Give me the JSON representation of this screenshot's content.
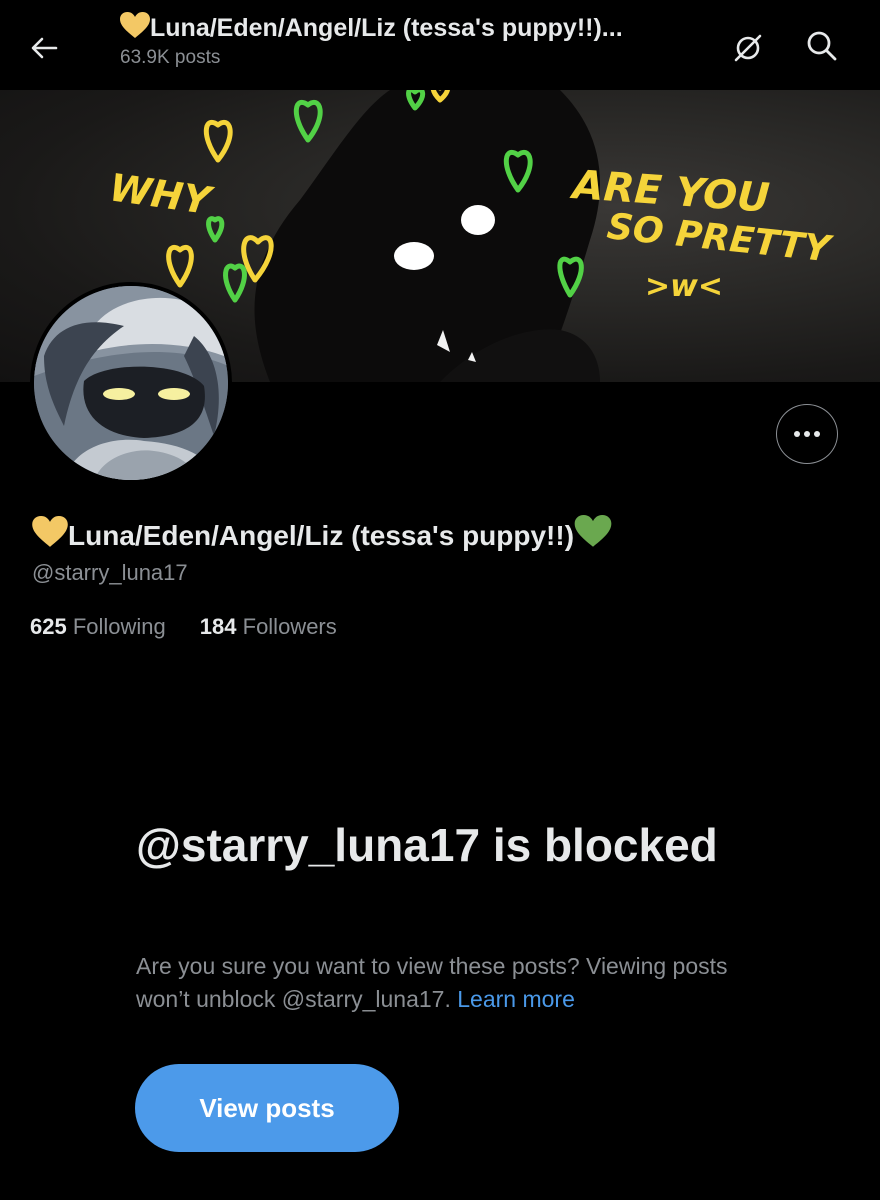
{
  "header": {
    "title": "Luna/Eden/Angel/Liz (tessa's puppy!!)...",
    "posts_count": "63.9K posts",
    "back_icon": "arrow-left-icon",
    "mute_icon": "mute-icon",
    "search_icon": "search-icon"
  },
  "banner": {
    "text_left": "WHY",
    "text_right_line1": "ARE YOU",
    "text_right_line2": "SO PRETTY",
    "text_right_line3": ">w<"
  },
  "profile": {
    "display_name": "Luna/Eden/Angel/Liz (tessa's puppy!!)",
    "handle": "@starry_luna17",
    "following_count": "625",
    "following_label": "Following",
    "followers_count": "184",
    "followers_label": "Followers",
    "more_icon": "more-options-icon"
  },
  "blocked": {
    "title": "@starry_luna17 is blocked",
    "description": "Are you sure you want to view these posts? Viewing posts won’t unblock @starry_luna17.",
    "learn_more": "Learn more",
    "button_label": "View posts"
  },
  "colors": {
    "background": "#000000",
    "accent": "#4c9aea",
    "link": "#4a99e9",
    "muted_text": "#8b8f94",
    "heart_yellow": "#f3c865",
    "heart_green": "#6aa84f",
    "doodle_yellow": "#f5d43a",
    "doodle_green": "#52d146"
  }
}
